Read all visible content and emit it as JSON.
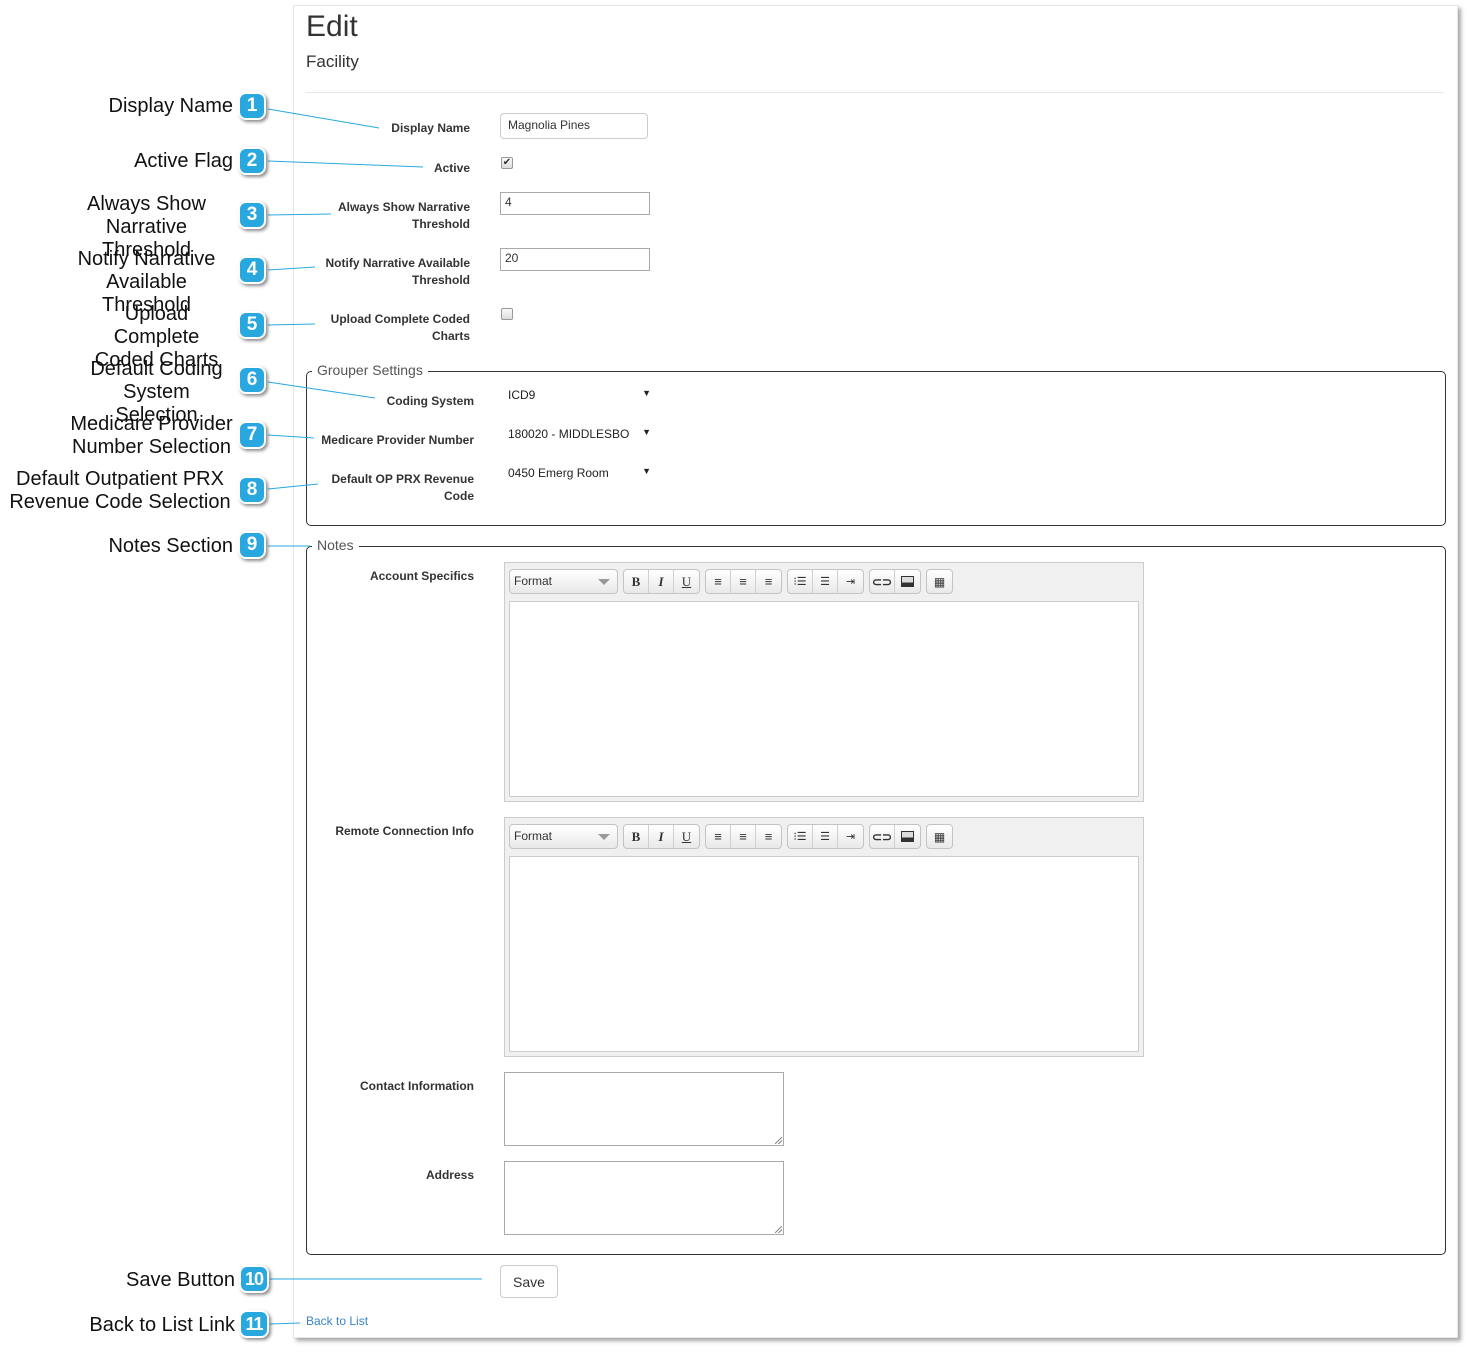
{
  "header": {
    "title": "Edit",
    "subtitle": "Facility"
  },
  "form": {
    "display_name": {
      "label": "Display Name",
      "value": "Magnolia Pines"
    },
    "active": {
      "label": "Active",
      "checked": true
    },
    "always_show": {
      "label_line1": "Always Show Narrative",
      "label_line2": "Threshold",
      "value": "4"
    },
    "notify": {
      "label_line1": "Notify Narrative Available",
      "label_line2": "Threshold",
      "value": "20"
    },
    "upload": {
      "label_line1": "Upload Complete Coded",
      "label_line2": "Charts",
      "checked": false
    }
  },
  "grouper": {
    "legend": "Grouper Settings",
    "coding_system": {
      "label": "Coding System",
      "value": "ICD9"
    },
    "medicare": {
      "label": "Medicare Provider Number",
      "value": "180020 - MIDDLESBO"
    },
    "revenue": {
      "label_line1": "Default OP PRX Revenue",
      "label_line2": "Code",
      "value": "0450 Emerg Room"
    }
  },
  "notes": {
    "legend": "Notes",
    "account_specifics": {
      "label": "Account Specifics"
    },
    "remote_connection": {
      "label": "Remote Connection Info"
    },
    "contact_information": {
      "label": "Contact Information"
    },
    "address": {
      "label": "Address"
    },
    "toolbar": {
      "format_label": "Format",
      "buttons": [
        "bold-icon",
        "italic-icon",
        "underline-icon",
        "align-left-icon",
        "align-center-icon",
        "align-right-icon",
        "bulleted-list-icon",
        "numbered-list-icon",
        "indent-icon",
        "link-icon",
        "image-icon",
        "table-icon"
      ],
      "bold": "B",
      "italic": "I",
      "underline": "U"
    }
  },
  "actions": {
    "save_label": "Save",
    "back_label": "Back to List"
  },
  "annotations": {
    "color": "#29a8e0",
    "items": [
      {
        "num": "1",
        "line1": "Display Name",
        "line2": ""
      },
      {
        "num": "2",
        "line1": "Active Flag",
        "line2": ""
      },
      {
        "num": "3",
        "line1": "Always Show",
        "line2": "Narrative Threshold"
      },
      {
        "num": "4",
        "line1": "Notify Narrative",
        "line2": "Available Threshold"
      },
      {
        "num": "5",
        "line1": "Upload Complete",
        "line2": "Coded Charts"
      },
      {
        "num": "6",
        "line1": "Default Coding",
        "line2": "System Selection"
      },
      {
        "num": "7",
        "line1": "Medicare Provider",
        "line2": "Number Selection"
      },
      {
        "num": "8",
        "line1": "Default Outpatient PRX",
        "line2": "Revenue Code Selection"
      },
      {
        "num": "9",
        "line1": "Notes Section",
        "line2": ""
      },
      {
        "num": "10",
        "line1": "Save Button",
        "line2": ""
      },
      {
        "num": "11",
        "line1": "Back to List Link",
        "line2": ""
      }
    ]
  }
}
